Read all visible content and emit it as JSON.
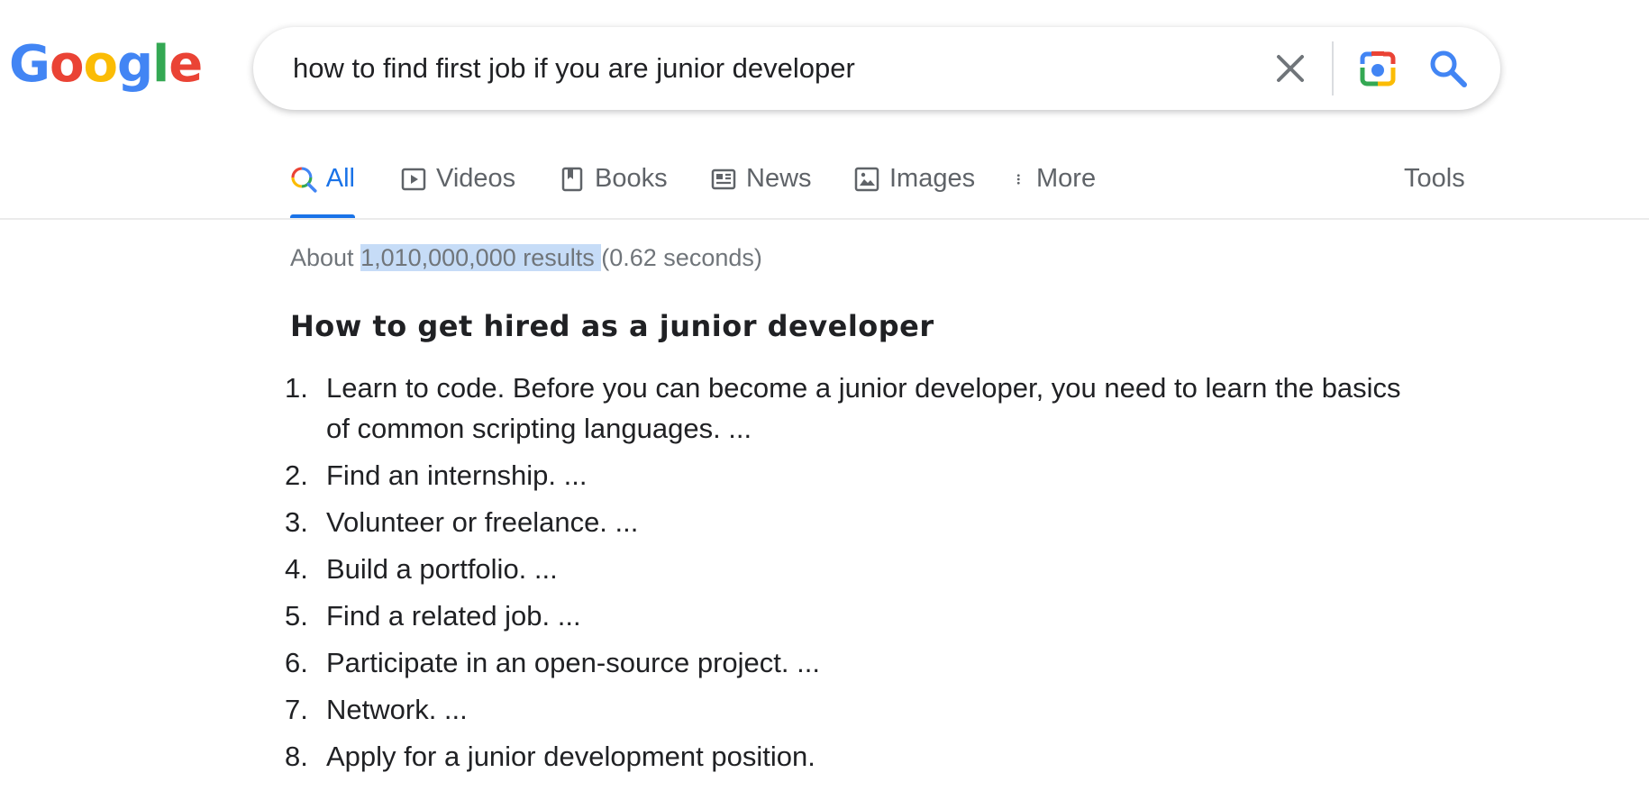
{
  "logo": {
    "letters": [
      "G",
      "o",
      "o",
      "g",
      "l",
      "e"
    ],
    "colors": [
      "#4285F4",
      "#EA4335",
      "#FBBC05",
      "#4285F4",
      "#34A853",
      "#EA4335"
    ]
  },
  "search": {
    "query": "how to find first job if you are junior developer"
  },
  "tabs": [
    {
      "label": "All",
      "icon": "search-multicolor-icon",
      "active": true
    },
    {
      "label": "Videos",
      "icon": "play-icon",
      "active": false
    },
    {
      "label": "Books",
      "icon": "book-icon",
      "active": false
    },
    {
      "label": "News",
      "icon": "newspaper-icon",
      "active": false
    },
    {
      "label": "Images",
      "icon": "image-icon",
      "active": false
    },
    {
      "label": "More",
      "icon": "more-vert-icon",
      "active": false
    }
  ],
  "tools_label": "Tools",
  "stats": {
    "prefix": "About ",
    "count": "1,010,000,000 results ",
    "time": "(0.62 seconds)"
  },
  "snippet": {
    "title": "How to get hired as a junior developer",
    "items": [
      {
        "num": "1.",
        "text": "Learn to code. Before you can become a junior developer, you need to learn the basics of common scripting languages. ..."
      },
      {
        "num": "2.",
        "text": "Find an internship. ..."
      },
      {
        "num": "3.",
        "text": "Volunteer or freelance. ..."
      },
      {
        "num": "4.",
        "text": "Build a portfolio. ..."
      },
      {
        "num": "5.",
        "text": "Find a related job. ..."
      },
      {
        "num": "6.",
        "text": "Participate in an open-source project. ..."
      },
      {
        "num": "7.",
        "text": "Network. ..."
      },
      {
        "num": "8.",
        "text": "Apply for a junior development position."
      }
    ]
  },
  "colors": {
    "accent": "#1a73e8",
    "selection_highlight": "#c6dcf7"
  }
}
